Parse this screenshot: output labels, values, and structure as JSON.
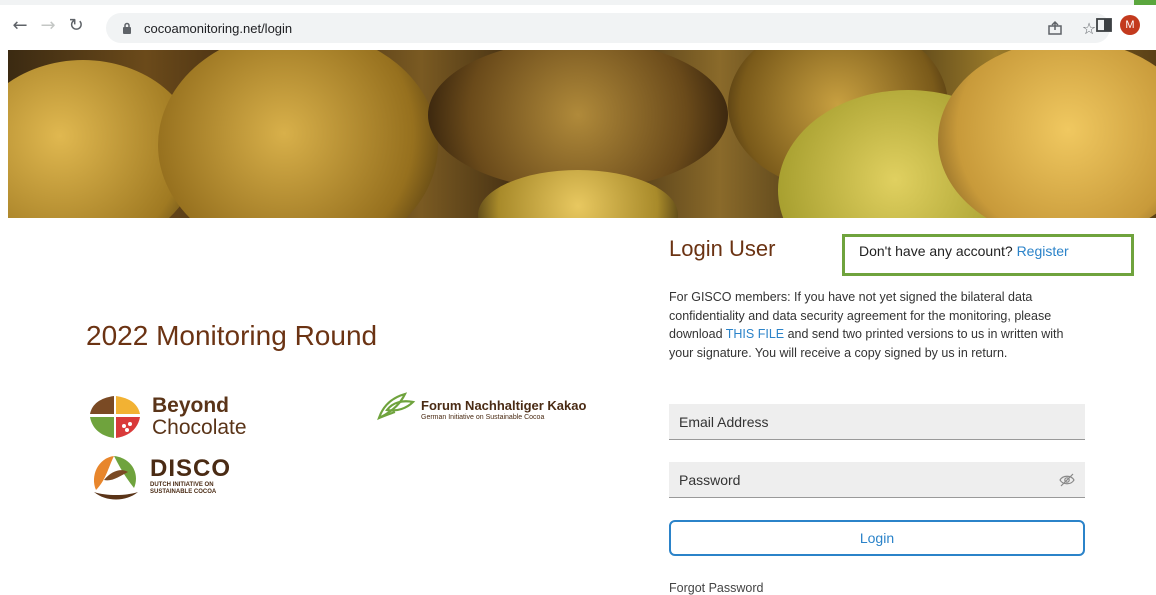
{
  "browser": {
    "url": "cocoamonitoring.net/login",
    "profile_initial": "M",
    "nav_icons": [
      "back-icon",
      "forward-icon",
      "reload-icon"
    ],
    "omnibox_icons": [
      "share-icon",
      "bookmark-star-icon"
    ]
  },
  "banner": {
    "description": ""
  },
  "left": {
    "round_title": "2022 Monitoring Round",
    "beyond": {
      "line1": "Beyond",
      "line2": "Chocolate"
    },
    "disco": {
      "name": "DISCO",
      "line1": "DUTCH INITIATIVE ON",
      "line2": "SUSTAINABLE COCOA"
    },
    "forum": {
      "name": "Forum Nachhaltiger Kakao",
      "sub": "German Initiative on Sustainable Cocoa"
    }
  },
  "login": {
    "title": "Login User",
    "register_prompt": "Don't have any account?",
    "register_link": "Register",
    "notice_before": "For GISCO members: If you have not yet signed the bilateral data confidentiality and data security agreement for the monitoring, please download ",
    "notice_link": "THIS FILE",
    "notice_after": " and send two printed versions to us in written with your signature. You will receive a copy signed by us in return.",
    "email_placeholder": "Email Address",
    "password_placeholder": "Password",
    "login_button": "Login",
    "forgot_password": "Forgot Password"
  },
  "colors": {
    "brand_brown": "#6b3313",
    "link_blue": "#2b83c9",
    "highlight_green": "#6fa33d"
  }
}
